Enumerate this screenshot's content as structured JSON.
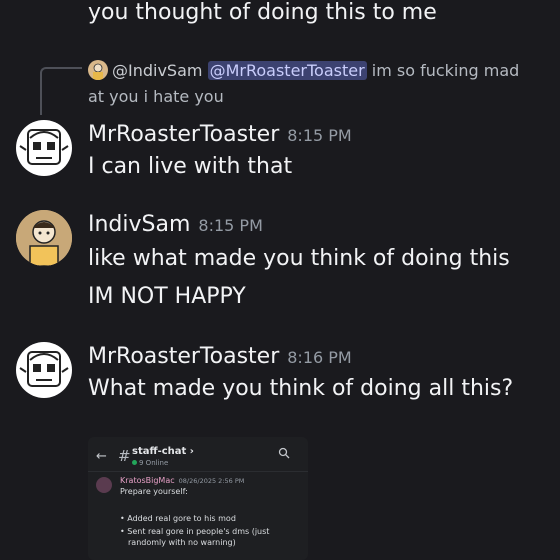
{
  "previous_line": "you thought of doing this to me",
  "reply": {
    "author": "@IndivSam",
    "mention": "@MrRoasterToaster",
    "text_after_mention": " im so fucking mad",
    "text_line2": "at you i hate you"
  },
  "messages": [
    {
      "author": "MrRoasterToaster",
      "time": "8:15 PM",
      "lines": [
        "I can live with that"
      ]
    },
    {
      "author": "IndivSam",
      "time": "8:15 PM",
      "lines": [
        "like what made you think of doing this",
        "IM NOT HAPPY"
      ]
    },
    {
      "author": "MrRoasterToaster",
      "time": "8:16 PM",
      "lines": [
        "What made you think of doing all this?"
      ]
    }
  ],
  "embed": {
    "channel_name": "staff-chat",
    "channel_chevron": "›",
    "online": "9 Online",
    "author": "KratosBigMac",
    "date": "08/26/2025 2:56 PM",
    "line1": "Prepare yourself:",
    "line2": "• Added real gore to his mod",
    "line3": "• Sent real gore in people's dms (just",
    "line4": "randomly with no warning)",
    "line5": ""
  },
  "colors": {
    "background": "#1a1a1e",
    "mention_bg": "#3c4270",
    "mention_text": "#c9cdfb",
    "timestamp": "#949ba4"
  }
}
